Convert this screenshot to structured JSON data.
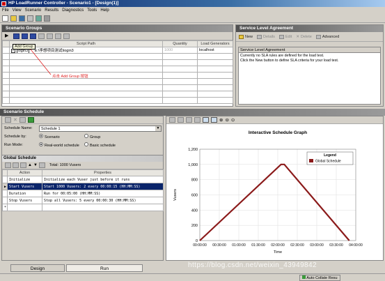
{
  "window": {
    "title": "HP LoadRunner Controller - Scenario1 - [Design(1)]"
  },
  "menu": [
    "File",
    "View",
    "Scenario",
    "Results",
    "Diagnostics",
    "Tools",
    "Help"
  ],
  "scenario_groups": {
    "title": "Scenario Groups",
    "tooltip": "Add Group",
    "columns": [
      "Script Path",
      "Quantity",
      "Load Generators"
    ],
    "rows": [
      {
        "name": "login3",
        "path": "E:\\李想项目测试\\login3",
        "quantity": "1000",
        "generator": "localhost"
      }
    ],
    "annotation": "点击 Add Group 按钮"
  },
  "sla": {
    "title": "Service Level Agreement",
    "buttons": {
      "new": "New",
      "details": "Details",
      "edit": "Edit",
      "delete": "Delete",
      "advanced": "Advanced"
    },
    "box_title": "Service Level Agreement",
    "line1": "Currently no SLA rules are defined for the load test.",
    "line2": "Click the New button to define SLA criteria for your load test."
  },
  "schedule": {
    "title": "Scenario Schedule",
    "name_label": "Schedule Name:",
    "name_value": "Schedule 1",
    "by_label": "Schedule by:",
    "by_scenario": "Scenario",
    "by_group": "Group",
    "mode_label": "Run Mode:",
    "mode_real": "Real-world schedule",
    "mode_basic": "Basic schedule",
    "global_title": "Global Schedule",
    "total": "Total: 1000 Vusers",
    "columns": [
      "Action",
      "Properties"
    ],
    "actions": [
      {
        "action": "Initialize",
        "props": "Initialize each Vuser just before it runs"
      },
      {
        "action": "Start Vusers",
        "props": "Start 1000 Vusers: 2 every 00:00:15 (HH:MM:SS)"
      },
      {
        "action": "Duration",
        "props": "Run for 00:05:00 (HH:MM:SS)"
      },
      {
        "action": "Stop Vusers",
        "props": "Stop all Vusers: 5 every 00:00:30 (HH:MM:SS)"
      }
    ],
    "new_row_marker": "*"
  },
  "chart_data": {
    "type": "line",
    "title": "Interactive Schedule Graph",
    "xlabel": "Time",
    "ylabel": "Vusers",
    "ylim": [
      0,
      1200
    ],
    "yticks": [
      0,
      200,
      400,
      600,
      800,
      "1,000",
      "1,200"
    ],
    "xticks": [
      "00:00:00",
      "00:30:00",
      "01:00:00",
      "01:30:00",
      "02:00:00",
      "02:30:00",
      "03:00:00",
      "03:30:00",
      "04:00:00"
    ],
    "legend": {
      "title": "Legend",
      "placement": "top-right",
      "entries": [
        "Global Schedule"
      ]
    },
    "series": [
      {
        "name": "Global Schedule",
        "color": "#8b1a1a",
        "x_minutes": [
          0,
          125,
          130,
          230
        ],
        "y": [
          0,
          1000,
          1000,
          0
        ]
      }
    ]
  },
  "tabs": {
    "design": "Design",
    "run": "Run"
  },
  "status": {
    "collate": "Auto Collate Resu",
    "watermark": "https://blog.csdn.net/weixin_43949842"
  }
}
